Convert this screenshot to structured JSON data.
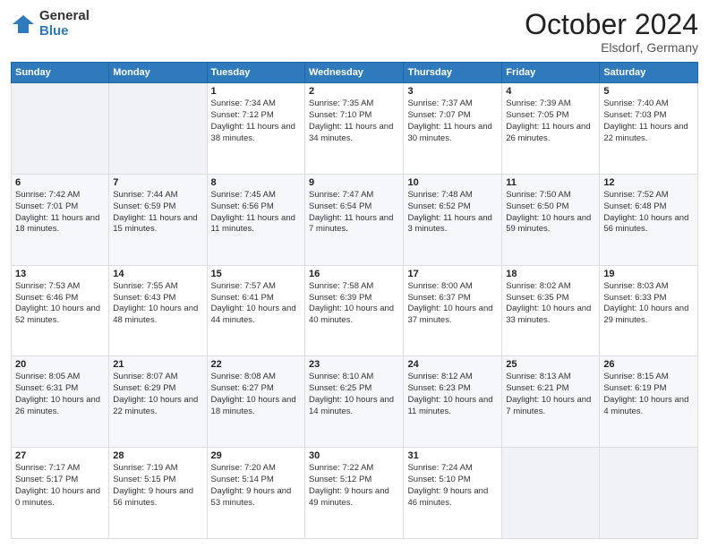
{
  "logo": {
    "general": "General",
    "blue": "Blue"
  },
  "header": {
    "month": "October 2024",
    "location": "Elsdorf, Germany"
  },
  "weekdays": [
    "Sunday",
    "Monday",
    "Tuesday",
    "Wednesday",
    "Thursday",
    "Friday",
    "Saturday"
  ],
  "weeks": [
    [
      {
        "day": "",
        "sunrise": "",
        "sunset": "",
        "daylight": ""
      },
      {
        "day": "",
        "sunrise": "",
        "sunset": "",
        "daylight": ""
      },
      {
        "day": "1",
        "sunrise": "Sunrise: 7:34 AM",
        "sunset": "Sunset: 7:12 PM",
        "daylight": "Daylight: 11 hours and 38 minutes."
      },
      {
        "day": "2",
        "sunrise": "Sunrise: 7:35 AM",
        "sunset": "Sunset: 7:10 PM",
        "daylight": "Daylight: 11 hours and 34 minutes."
      },
      {
        "day": "3",
        "sunrise": "Sunrise: 7:37 AM",
        "sunset": "Sunset: 7:07 PM",
        "daylight": "Daylight: 11 hours and 30 minutes."
      },
      {
        "day": "4",
        "sunrise": "Sunrise: 7:39 AM",
        "sunset": "Sunset: 7:05 PM",
        "daylight": "Daylight: 11 hours and 26 minutes."
      },
      {
        "day": "5",
        "sunrise": "Sunrise: 7:40 AM",
        "sunset": "Sunset: 7:03 PM",
        "daylight": "Daylight: 11 hours and 22 minutes."
      }
    ],
    [
      {
        "day": "6",
        "sunrise": "Sunrise: 7:42 AM",
        "sunset": "Sunset: 7:01 PM",
        "daylight": "Daylight: 11 hours and 18 minutes."
      },
      {
        "day": "7",
        "sunrise": "Sunrise: 7:44 AM",
        "sunset": "Sunset: 6:59 PM",
        "daylight": "Daylight: 11 hours and 15 minutes."
      },
      {
        "day": "8",
        "sunrise": "Sunrise: 7:45 AM",
        "sunset": "Sunset: 6:56 PM",
        "daylight": "Daylight: 11 hours and 11 minutes."
      },
      {
        "day": "9",
        "sunrise": "Sunrise: 7:47 AM",
        "sunset": "Sunset: 6:54 PM",
        "daylight": "Daylight: 11 hours and 7 minutes."
      },
      {
        "day": "10",
        "sunrise": "Sunrise: 7:48 AM",
        "sunset": "Sunset: 6:52 PM",
        "daylight": "Daylight: 11 hours and 3 minutes."
      },
      {
        "day": "11",
        "sunrise": "Sunrise: 7:50 AM",
        "sunset": "Sunset: 6:50 PM",
        "daylight": "Daylight: 10 hours and 59 minutes."
      },
      {
        "day": "12",
        "sunrise": "Sunrise: 7:52 AM",
        "sunset": "Sunset: 6:48 PM",
        "daylight": "Daylight: 10 hours and 56 minutes."
      }
    ],
    [
      {
        "day": "13",
        "sunrise": "Sunrise: 7:53 AM",
        "sunset": "Sunset: 6:46 PM",
        "daylight": "Daylight: 10 hours and 52 minutes."
      },
      {
        "day": "14",
        "sunrise": "Sunrise: 7:55 AM",
        "sunset": "Sunset: 6:43 PM",
        "daylight": "Daylight: 10 hours and 48 minutes."
      },
      {
        "day": "15",
        "sunrise": "Sunrise: 7:57 AM",
        "sunset": "Sunset: 6:41 PM",
        "daylight": "Daylight: 10 hours and 44 minutes."
      },
      {
        "day": "16",
        "sunrise": "Sunrise: 7:58 AM",
        "sunset": "Sunset: 6:39 PM",
        "daylight": "Daylight: 10 hours and 40 minutes."
      },
      {
        "day": "17",
        "sunrise": "Sunrise: 8:00 AM",
        "sunset": "Sunset: 6:37 PM",
        "daylight": "Daylight: 10 hours and 37 minutes."
      },
      {
        "day": "18",
        "sunrise": "Sunrise: 8:02 AM",
        "sunset": "Sunset: 6:35 PM",
        "daylight": "Daylight: 10 hours and 33 minutes."
      },
      {
        "day": "19",
        "sunrise": "Sunrise: 8:03 AM",
        "sunset": "Sunset: 6:33 PM",
        "daylight": "Daylight: 10 hours and 29 minutes."
      }
    ],
    [
      {
        "day": "20",
        "sunrise": "Sunrise: 8:05 AM",
        "sunset": "Sunset: 6:31 PM",
        "daylight": "Daylight: 10 hours and 26 minutes."
      },
      {
        "day": "21",
        "sunrise": "Sunrise: 8:07 AM",
        "sunset": "Sunset: 6:29 PM",
        "daylight": "Daylight: 10 hours and 22 minutes."
      },
      {
        "day": "22",
        "sunrise": "Sunrise: 8:08 AM",
        "sunset": "Sunset: 6:27 PM",
        "daylight": "Daylight: 10 hours and 18 minutes."
      },
      {
        "day": "23",
        "sunrise": "Sunrise: 8:10 AM",
        "sunset": "Sunset: 6:25 PM",
        "daylight": "Daylight: 10 hours and 14 minutes."
      },
      {
        "day": "24",
        "sunrise": "Sunrise: 8:12 AM",
        "sunset": "Sunset: 6:23 PM",
        "daylight": "Daylight: 10 hours and 11 minutes."
      },
      {
        "day": "25",
        "sunrise": "Sunrise: 8:13 AM",
        "sunset": "Sunset: 6:21 PM",
        "daylight": "Daylight: 10 hours and 7 minutes."
      },
      {
        "day": "26",
        "sunrise": "Sunrise: 8:15 AM",
        "sunset": "Sunset: 6:19 PM",
        "daylight": "Daylight: 10 hours and 4 minutes."
      }
    ],
    [
      {
        "day": "27",
        "sunrise": "Sunrise: 7:17 AM",
        "sunset": "Sunset: 5:17 PM",
        "daylight": "Daylight: 10 hours and 0 minutes."
      },
      {
        "day": "28",
        "sunrise": "Sunrise: 7:19 AM",
        "sunset": "Sunset: 5:15 PM",
        "daylight": "Daylight: 9 hours and 56 minutes."
      },
      {
        "day": "29",
        "sunrise": "Sunrise: 7:20 AM",
        "sunset": "Sunset: 5:14 PM",
        "daylight": "Daylight: 9 hours and 53 minutes."
      },
      {
        "day": "30",
        "sunrise": "Sunrise: 7:22 AM",
        "sunset": "Sunset: 5:12 PM",
        "daylight": "Daylight: 9 hours and 49 minutes."
      },
      {
        "day": "31",
        "sunrise": "Sunrise: 7:24 AM",
        "sunset": "Sunset: 5:10 PM",
        "daylight": "Daylight: 9 hours and 46 minutes."
      },
      {
        "day": "",
        "sunrise": "",
        "sunset": "",
        "daylight": ""
      },
      {
        "day": "",
        "sunrise": "",
        "sunset": "",
        "daylight": ""
      }
    ]
  ]
}
